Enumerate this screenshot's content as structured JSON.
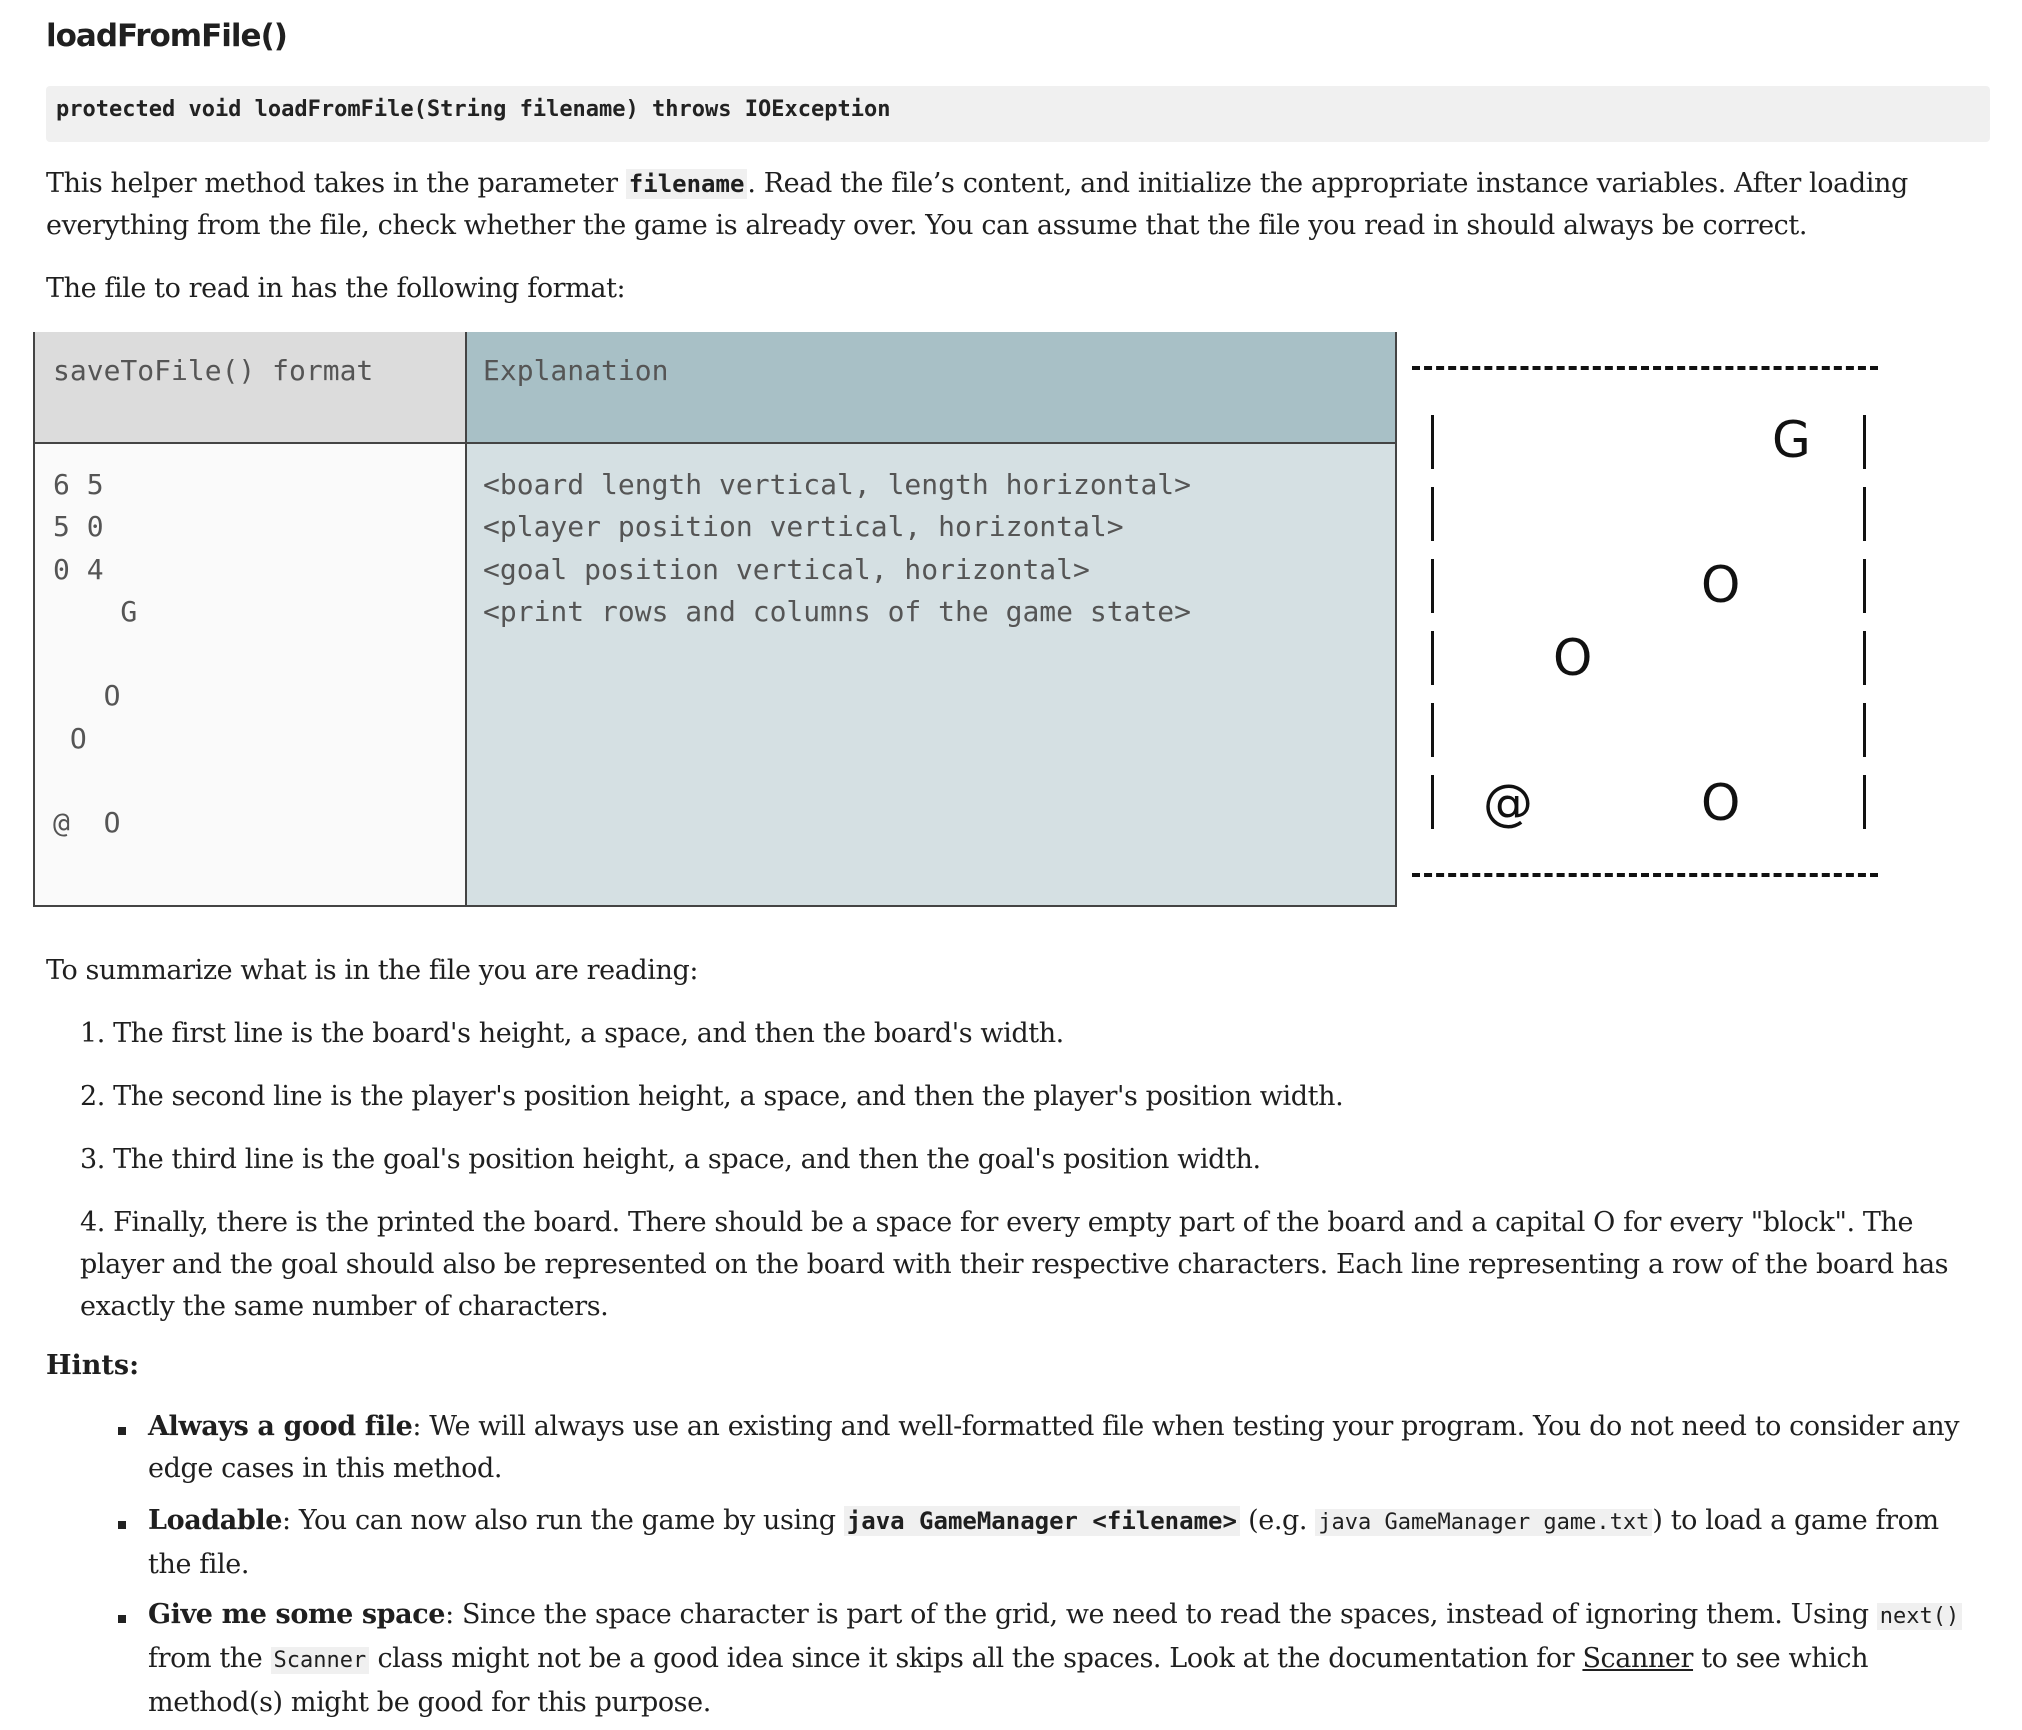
{
  "title": "loadFromFile()",
  "signature": "protected void loadFromFile(String filename) throws IOException",
  "intro": {
    "prefix": "This helper method takes in the parameter ",
    "param": "filename",
    "suffix": ". Read the file’s content, and initialize the appropriate instance variables. After loading everything from the file, check whether the game is already over. You can assume that the file you read in should always be correct."
  },
  "format_line": "The file to read in has the following format:",
  "table": {
    "header_left": "saveToFile() format",
    "header_right": "Explanation",
    "left_code": "6 5\n5 0\n0 4\n    G\n\n   O\n O\n\n@  O",
    "right_code": "<board length vertical, length horizontal>\n<player position vertical, horizontal>\n<goal position vertical, horizontal>\n<print rows and columns of the game state>"
  },
  "board": {
    "goal": "G",
    "player": "@",
    "block": "O"
  },
  "summary_intro": "To summarize what is in the file you are reading:",
  "list": [
    "1.  The first line is the board's height, a space, and then the board's width.",
    "2. The second line is the player's position height, a space, and then the player's position width.",
    "3. The third line is the goal's position height, a space, and then  the goal's position width.",
    "4. Finally, there is the printed the board. There should be a space for every empty part of the board and a capital O for every \"block\". The player and the goal should also be represented on the board with their respective characters. Each line representing a row of the board has exactly the same number of characters."
  ],
  "hints_label": "Hints:",
  "hints": {
    "h1_title": "Always a good file",
    "h1_text": ": We will always use an existing and well-formatted file when testing your program. You do not need to consider any edge cases in this method.",
    "h2_title": "Loadable",
    "h2_text1": ": You can now also run the game by using ",
    "h2_code1": "java GameManager <filename>",
    "h2_text2": " (e.g. ",
    "h2_code2": "java GameManager game.txt",
    "h2_text3": ") to load a game from the file.",
    "h3_title": "Give me some space",
    "h3_text1": ": Since the space character is part of the grid, we need to read the spaces, instead of ignoring them. Using ",
    "h3_code1": "next()",
    "h3_text2": " from the ",
    "h3_code2": "Scanner",
    "h3_text3": " class might not be a good idea since it skips all the spaces. Look at the documentation for ",
    "h3_link": "Scanner",
    "h3_text4": " to see which method(s) might be good for this purpose."
  }
}
